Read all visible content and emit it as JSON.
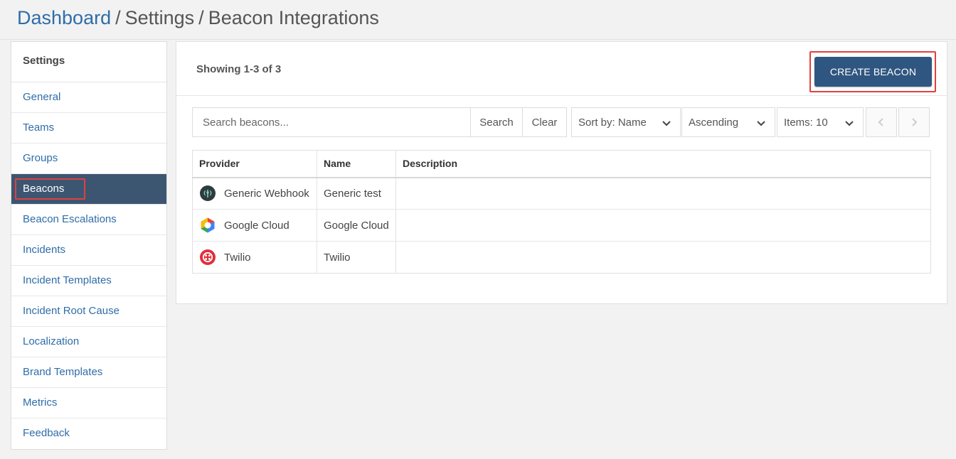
{
  "breadcrumb": {
    "root": "Dashboard",
    "separator": "/",
    "section": "Settings",
    "page": "Beacon Integrations"
  },
  "sidebar": {
    "title": "Settings",
    "items": [
      {
        "label": "General",
        "active": false
      },
      {
        "label": "Teams",
        "active": false
      },
      {
        "label": "Groups",
        "active": false
      },
      {
        "label": "Beacons",
        "active": true
      },
      {
        "label": "Beacon Escalations",
        "active": false
      },
      {
        "label": "Incidents",
        "active": false
      },
      {
        "label": "Incident Templates",
        "active": false
      },
      {
        "label": "Incident Root Cause",
        "active": false
      },
      {
        "label": "Localization",
        "active": false
      },
      {
        "label": "Brand Templates",
        "active": false
      },
      {
        "label": "Metrics",
        "active": false
      },
      {
        "label": "Feedback",
        "active": false
      }
    ]
  },
  "main": {
    "showing": "Showing 1-3 of 3",
    "create_label": "CREATE BEACON",
    "search": {
      "placeholder": "Search beacons...",
      "value": ""
    },
    "search_label": "Search",
    "clear_label": "Clear",
    "sort_label": "Sort by: Name",
    "order_label": "Ascending",
    "items_label": "Items: 10",
    "table": {
      "headers": {
        "provider": "Provider",
        "name": "Name",
        "description": "Description"
      },
      "rows": [
        {
          "provider": "Generic Webhook",
          "icon": "webhook-icon",
          "name": "Generic test",
          "description": ""
        },
        {
          "provider": "Google Cloud",
          "icon": "google-cloud-icon",
          "name": "Google Cloud",
          "description": ""
        },
        {
          "provider": "Twilio",
          "icon": "twilio-icon",
          "name": "Twilio",
          "description": ""
        }
      ]
    }
  },
  "colors": {
    "link": "#2f6da8",
    "active_nav": "#3c5672",
    "primary_button": "#2f5680",
    "highlight": "#e04040"
  }
}
